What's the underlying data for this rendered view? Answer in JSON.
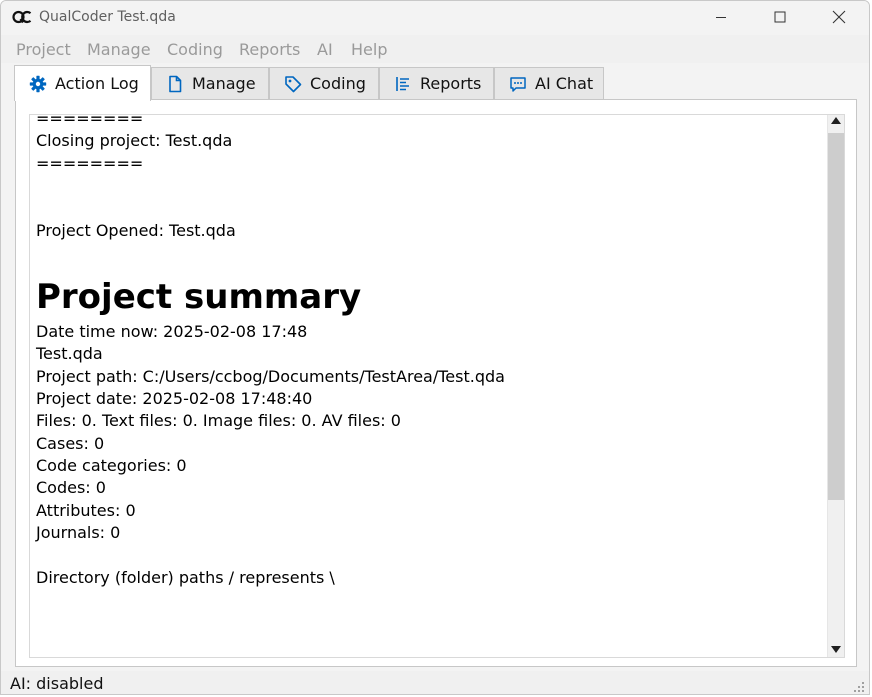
{
  "window": {
    "title": "QualCoder Test.qda"
  },
  "menu": [
    "Project",
    "Manage",
    "Coding",
    "Reports",
    "AI",
    "Help"
  ],
  "tabs": [
    {
      "label": "Action Log",
      "icon": "gear-icon"
    },
    {
      "label": "Manage",
      "icon": "document-icon"
    },
    {
      "label": "Coding",
      "icon": "tag-icon"
    },
    {
      "label": "Reports",
      "icon": "list-icon"
    },
    {
      "label": "AI Chat",
      "icon": "chat-icon"
    }
  ],
  "log": {
    "line1": "========",
    "line2": "Closing project: Test.qda",
    "line3": "========",
    "line4": "Project Opened: Test.qda",
    "heading": "Project summary",
    "summary": [
      "Date time now: 2025-02-08 17:48",
      "Test.qda",
      "Project path: C:/Users/ccbog/Documents/TestArea/Test.qda",
      "Project date: 2025-02-08 17:48:40",
      "Files: 0. Text files: 0. Image files: 0. AV files: 0",
      "Cases: 0",
      "Code categories: 0",
      "Codes: 0",
      "Attributes: 0",
      "Journals: 0"
    ],
    "footer": "Directory (folder) paths / represents \\"
  },
  "status": {
    "text": "AI: disabled"
  },
  "colors": {
    "accent": "#0067c0",
    "menu_disabled": "#9a9a9a"
  }
}
